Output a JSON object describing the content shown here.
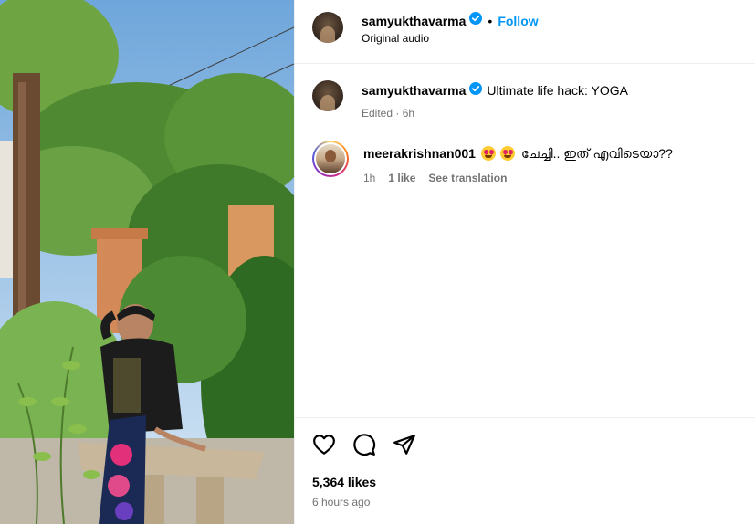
{
  "post": {
    "media_alt": "Yoga post photo",
    "owner": {
      "username": "samyukthavarma",
      "verified": true,
      "follow_label": "Follow",
      "separator": "•",
      "audio": "Original audio"
    },
    "caption": {
      "username": "samyukthavarma",
      "text": "Ultimate life hack: YOGA",
      "meta": "Edited · 6h"
    },
    "comments": [
      {
        "username": "meerakrishnan001",
        "text": "ചേച്ചി.. ഇത് എവിടെയാ??",
        "time": "1h",
        "likes": "1 like",
        "translate_label": "See translation"
      }
    ],
    "likes": "5,364 likes",
    "timestamp": "6 hours ago"
  },
  "icons": [
    "heart-icon",
    "comment-icon",
    "share-icon"
  ],
  "colors": {
    "accent": "#0095f6",
    "verified": "#0095f6",
    "muted": "#737373"
  }
}
